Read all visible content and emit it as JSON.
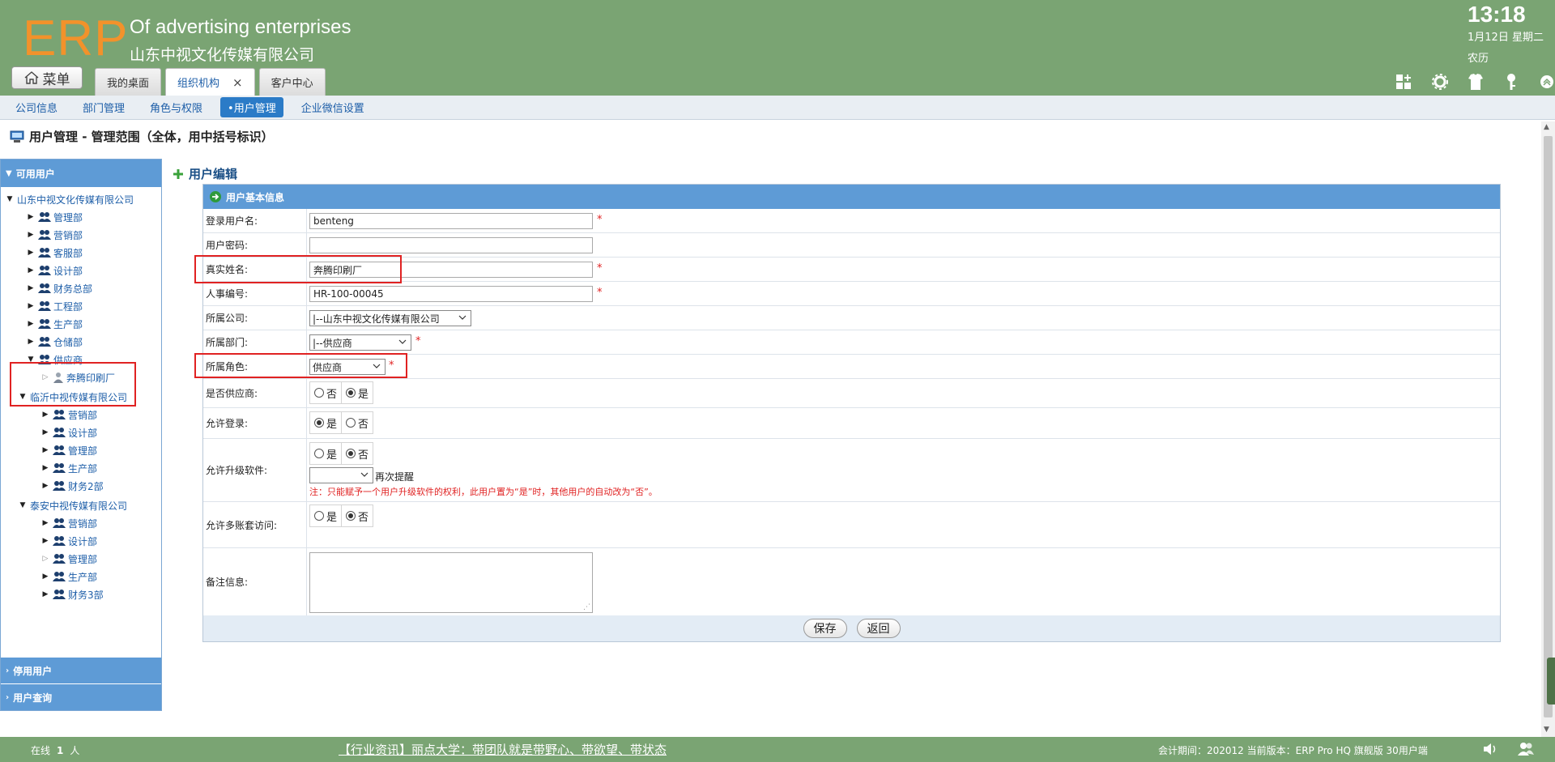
{
  "header": {
    "logo": "ERP",
    "tagline": "Of advertising enterprises",
    "company": "山东中视文化传媒有限公司",
    "time": "13:18",
    "date": "1月12日 星期二",
    "lunar": "农历",
    "menu_label": "菜单",
    "tabs": [
      {
        "label": "我的桌面"
      },
      {
        "label": "组织机构",
        "close": "×"
      },
      {
        "label": "客户中心"
      }
    ],
    "icons": [
      "grid-add-icon",
      "gear-icon",
      "shirt-icon",
      "key-icon",
      "collapse-up-icon"
    ]
  },
  "subnav": {
    "items": [
      "公司信息",
      "部门管理",
      "角色与权限",
      "•用户管理",
      "企业微信设置"
    ],
    "active_index": 3
  },
  "page": {
    "title": "用户管理 - 管理范围（全体，用中括号标识）"
  },
  "sidebar": {
    "header": "可用用户",
    "tree": [
      {
        "label": "山东中视文化传媒有限公司",
        "level": 0,
        "type": "company",
        "expanded": true
      },
      {
        "label": "管理部",
        "level": 1,
        "type": "dept"
      },
      {
        "label": "营销部",
        "level": 1,
        "type": "dept"
      },
      {
        "label": "客服部",
        "level": 1,
        "type": "dept"
      },
      {
        "label": "设计部",
        "level": 1,
        "type": "dept"
      },
      {
        "label": "财务总部",
        "level": 1,
        "type": "dept"
      },
      {
        "label": "工程部",
        "level": 1,
        "type": "dept"
      },
      {
        "label": "生产部",
        "level": 1,
        "type": "dept"
      },
      {
        "label": "仓储部",
        "level": 1,
        "type": "dept"
      },
      {
        "label": "供应商",
        "level": 1,
        "type": "dept",
        "expanded": true
      },
      {
        "label": "奔腾印刷厂",
        "level": 2,
        "type": "user"
      },
      {
        "label": "临沂中视传媒有限公司",
        "level": 0,
        "type": "company",
        "expanded": true,
        "indent": 1
      },
      {
        "label": "营销部",
        "level": 2,
        "type": "dept"
      },
      {
        "label": "设计部",
        "level": 2,
        "type": "dept"
      },
      {
        "label": "管理部",
        "level": 2,
        "type": "dept"
      },
      {
        "label": "生产部",
        "level": 2,
        "type": "dept"
      },
      {
        "label": "财务2部",
        "level": 2,
        "type": "dept"
      },
      {
        "label": "泰安中视传媒有限公司",
        "level": 0,
        "type": "company",
        "expanded": true,
        "indent": 1
      },
      {
        "label": "营销部",
        "level": 2,
        "type": "dept"
      },
      {
        "label": "设计部",
        "level": 2,
        "type": "dept"
      },
      {
        "label": "管理部",
        "level": 2,
        "type": "dept",
        "hollow": true
      },
      {
        "label": "生产部",
        "level": 2,
        "type": "dept"
      },
      {
        "label": "财务3部",
        "level": 2,
        "type": "dept"
      }
    ],
    "footer_sections": [
      "停用用户",
      "用户查询"
    ]
  },
  "form": {
    "section_title": "用户编辑",
    "header": "用户基本信息",
    "required_mark": "*",
    "fields": {
      "login_name": {
        "label": "登录用户名:",
        "value": "benteng"
      },
      "password": {
        "label": "用户密码:",
        "value": ""
      },
      "real_name": {
        "label": "真实姓名:",
        "value": "奔腾印刷厂"
      },
      "hr_no": {
        "label": "人事编号:",
        "value": "HR-100-00045"
      },
      "company": {
        "label": "所属公司:",
        "value": "|--山东中视文化传媒有限公司"
      },
      "dept": {
        "label": "所属部门:",
        "value": "|--供应商"
      },
      "role": {
        "label": "所属角色:",
        "value": "供应商"
      },
      "is_supplier": {
        "label": "是否供应商:",
        "options": [
          "否",
          "是"
        ],
        "selected": "是"
      },
      "allow_login": {
        "label": "允许登录:",
        "options": [
          "是",
          "否"
        ],
        "selected": "是"
      },
      "allow_upgrade": {
        "label": "允许升级软件:",
        "options": [
          "是",
          "否"
        ],
        "selected": "否",
        "remind_value": "",
        "remind_label": "再次提醒",
        "note": "注：只能赋予一个用户升级软件的权利，此用户置为“是”时，其他用户的自动改为“否”。"
      },
      "multi_account": {
        "label": "允许多账套访问:",
        "options": [
          "是",
          "否"
        ],
        "selected": "否"
      },
      "remark": {
        "label": "备注信息:",
        "value": ""
      }
    },
    "save_label": "保存",
    "back_label": "返回"
  },
  "statusbar": {
    "online_label": "在线",
    "online_count": "1",
    "online_unit": "人",
    "news": "【行业资讯】丽点大学：带团队就是带野心、带欲望、带状态",
    "info": "会计期间：202012 当前版本：ERP Pro HQ 旗舰版 30用户端"
  },
  "colors": {
    "header_bg": "#7aa473",
    "logo": "#f2922b",
    "panel_blue": "#5e9bd6",
    "link_blue": "#1d5ea8",
    "highlight_red": "#e02222"
  }
}
